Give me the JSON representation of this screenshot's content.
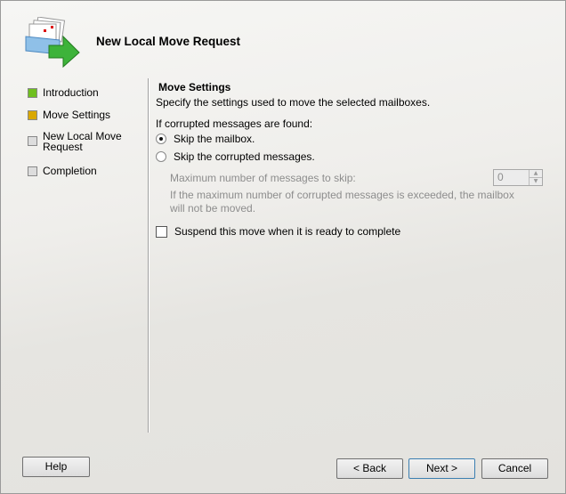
{
  "header": {
    "title": "New Local Move Request",
    "icon": "mailbox-move-icon"
  },
  "nav": [
    {
      "label": "Introduction",
      "state": "done",
      "color": "#6fbf1f"
    },
    {
      "label": "Move Settings",
      "state": "current",
      "color": "#d9a800"
    },
    {
      "label": "New Local Move Request",
      "state": "pending",
      "color": "#d8d8d8"
    },
    {
      "label": "Completion",
      "state": "pending",
      "color": "#d8d8d8"
    }
  ],
  "main": {
    "heading": "Move Settings",
    "description": "Specify the settings used to move the selected mailboxes.",
    "corrupt_label": "If corrupted messages are found:",
    "radio_skip_mailbox": "Skip the mailbox.",
    "radio_skip_messages": "Skip the corrupted messages.",
    "max_label": "Maximum number of messages to skip:",
    "max_value": "0",
    "max_note": "If the maximum number of corrupted messages is exceeded, the mailbox will not be moved.",
    "suspend_label": "Suspend this move when it is ready to complete"
  },
  "buttons": {
    "help": "Help",
    "back": "< Back",
    "next": "Next >",
    "cancel": "Cancel"
  }
}
